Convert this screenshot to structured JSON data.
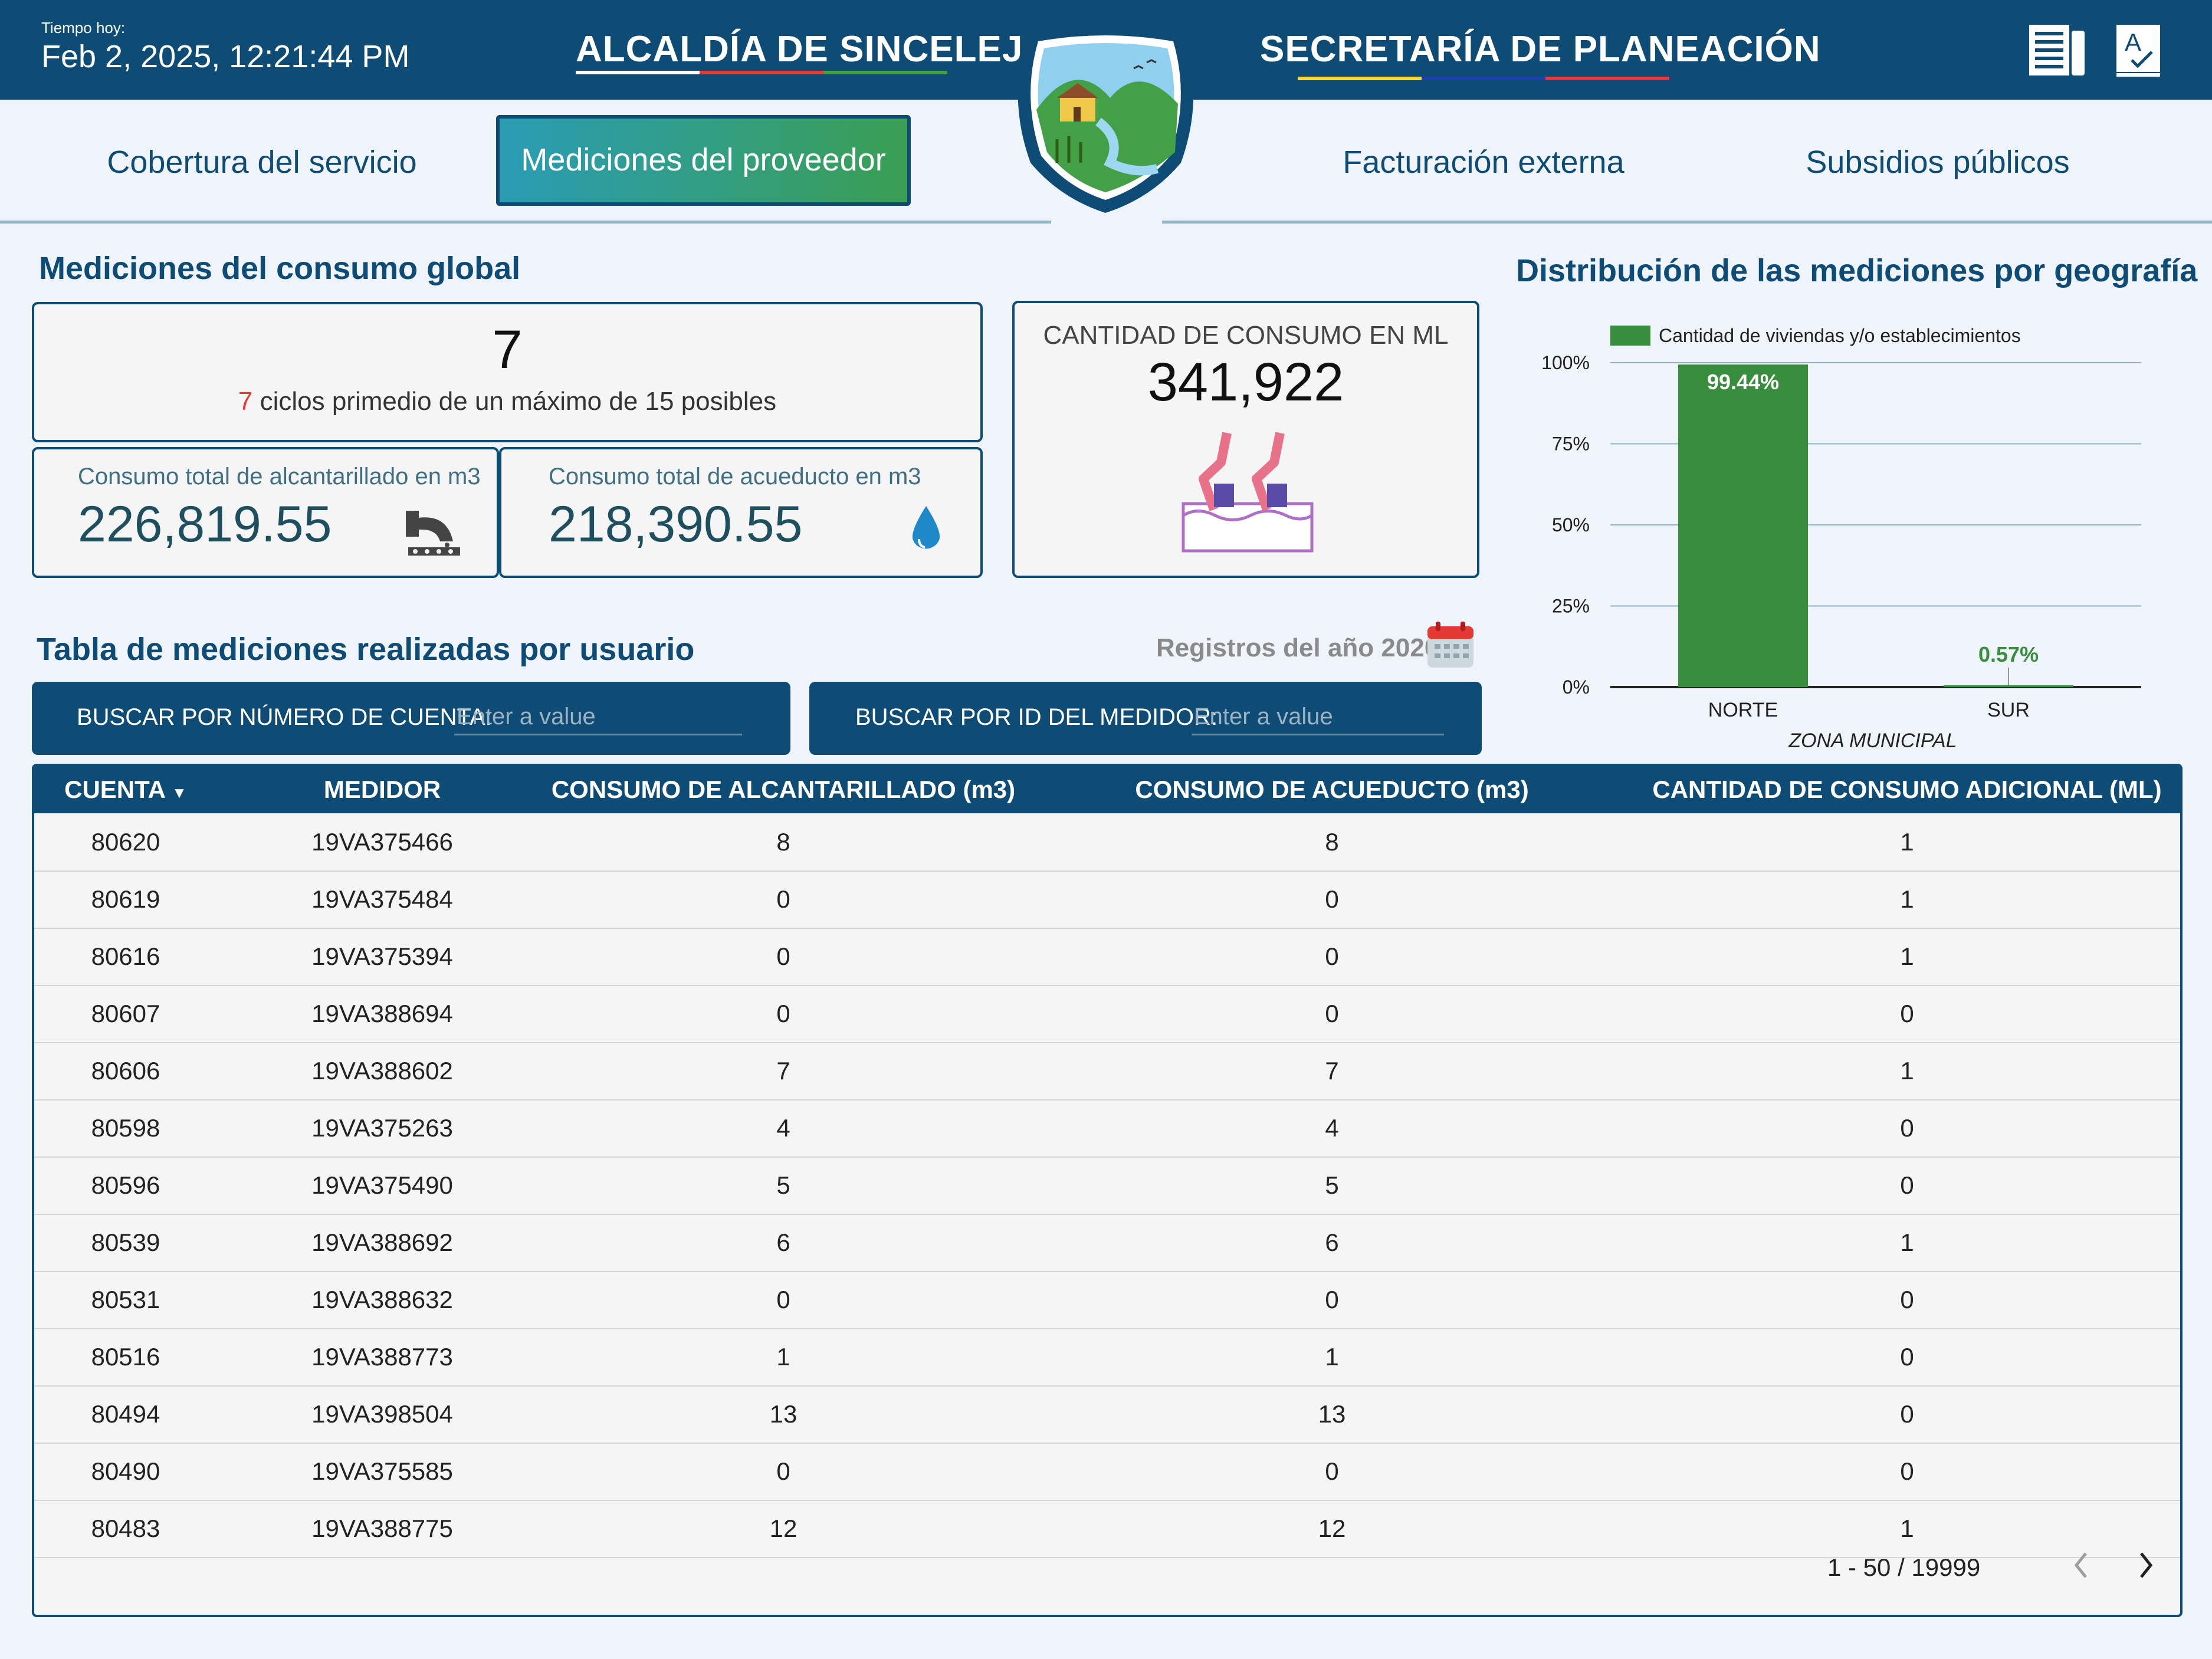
{
  "header": {
    "time_label": "Tiempo hoy:",
    "time_value": "Feb 2, 2025, 12:21:44 PM",
    "left_title": "ALCALDÍA DE SINCELEJO",
    "right_title": "SECRETARÍA DE PLANEACIÓN",
    "icons": [
      "report-icon",
      "spellcheck-icon"
    ]
  },
  "nav": {
    "tabs": [
      {
        "label": "Cobertura del servicio",
        "active": false
      },
      {
        "label": "Mediciones del proveedor",
        "active": true
      },
      {
        "label": "Facturación externa",
        "active": false
      },
      {
        "label": "Subsidios públicos",
        "active": false
      }
    ]
  },
  "consumo_global": {
    "title": "Mediciones del consumo global",
    "ciclos_value": "7",
    "ciclos_highlight": "7",
    "ciclos_text": " ciclos primedio de un máximo de 15 posibles",
    "ml_label": "CANTIDAD DE CONSUMO EN ML",
    "ml_value": "341,922",
    "alcantarillado_label": "Consumo total de alcantarillado en m3",
    "alcantarillado_value": "226,819.55",
    "acueducto_label": "Consumo total de acueducto en m3",
    "acueducto_value": "218,390.55"
  },
  "tabla": {
    "title": "Tabla de mediciones realizadas por usuario",
    "registros_label": "Registros del año 2020",
    "search_cuenta_label": "BUSCAR POR NÚMERO DE CUENTA:",
    "search_cuenta_placeholder": "Enter a value",
    "search_medidor_label": "BUSCAR POR ID DEL MEDIDOR:",
    "search_medidor_placeholder": "Enter a value",
    "columns": [
      "CUENTA",
      "MEDIDOR",
      "CONSUMO DE ALCANTARILLADO (m3)",
      "CONSUMO DE ACUEDUCTO (m3)",
      "CANTIDAD DE CONSUMO ADICIONAL (ML)"
    ],
    "rows": [
      [
        "80620",
        "19VA375466",
        "8",
        "8",
        "1"
      ],
      [
        "80619",
        "19VA375484",
        "0",
        "0",
        "1"
      ],
      [
        "80616",
        "19VA375394",
        "0",
        "0",
        "1"
      ],
      [
        "80607",
        "19VA388694",
        "0",
        "0",
        "0"
      ],
      [
        "80606",
        "19VA388602",
        "7",
        "7",
        "1"
      ],
      [
        "80598",
        "19VA375263",
        "4",
        "4",
        "0"
      ],
      [
        "80596",
        "19VA375490",
        "5",
        "5",
        "0"
      ],
      [
        "80539",
        "19VA388692",
        "6",
        "6",
        "1"
      ],
      [
        "80531",
        "19VA388632",
        "0",
        "0",
        "0"
      ],
      [
        "80516",
        "19VA388773",
        "1",
        "1",
        "0"
      ],
      [
        "80494",
        "19VA398504",
        "13",
        "13",
        "0"
      ],
      [
        "80490",
        "19VA375585",
        "0",
        "0",
        "0"
      ],
      [
        "80483",
        "19VA388775",
        "12",
        "12",
        "1"
      ]
    ],
    "pagination": "1 - 50 / 19999"
  },
  "chart_data": {
    "type": "bar",
    "title": "Distribución de las mediciones por geografía",
    "categories": [
      "NORTE",
      "SUR"
    ],
    "series": [
      {
        "name": "Cantidad de viviendas y/o establecimientos",
        "values": [
          99.44,
          0.57
        ]
      }
    ],
    "data_labels": [
      "99.44%",
      "0.57%"
    ],
    "xlabel": "ZONA MUNICIPAL",
    "ylabel": "",
    "ylim": [
      0,
      100
    ],
    "yticks": [
      "0%",
      "25%",
      "50%",
      "75%",
      "100%"
    ],
    "grid": true,
    "legend": "top-left",
    "colors": {
      "bar": "#388e3c",
      "label_outside": "#388e3c",
      "label_inside": "#ffffff"
    }
  },
  "colors": {
    "primary": "#0f4c75",
    "accent_red": "#e53935",
    "tab_gradient_start": "#2a9db5",
    "tab_gradient_end": "#3a9e53"
  }
}
